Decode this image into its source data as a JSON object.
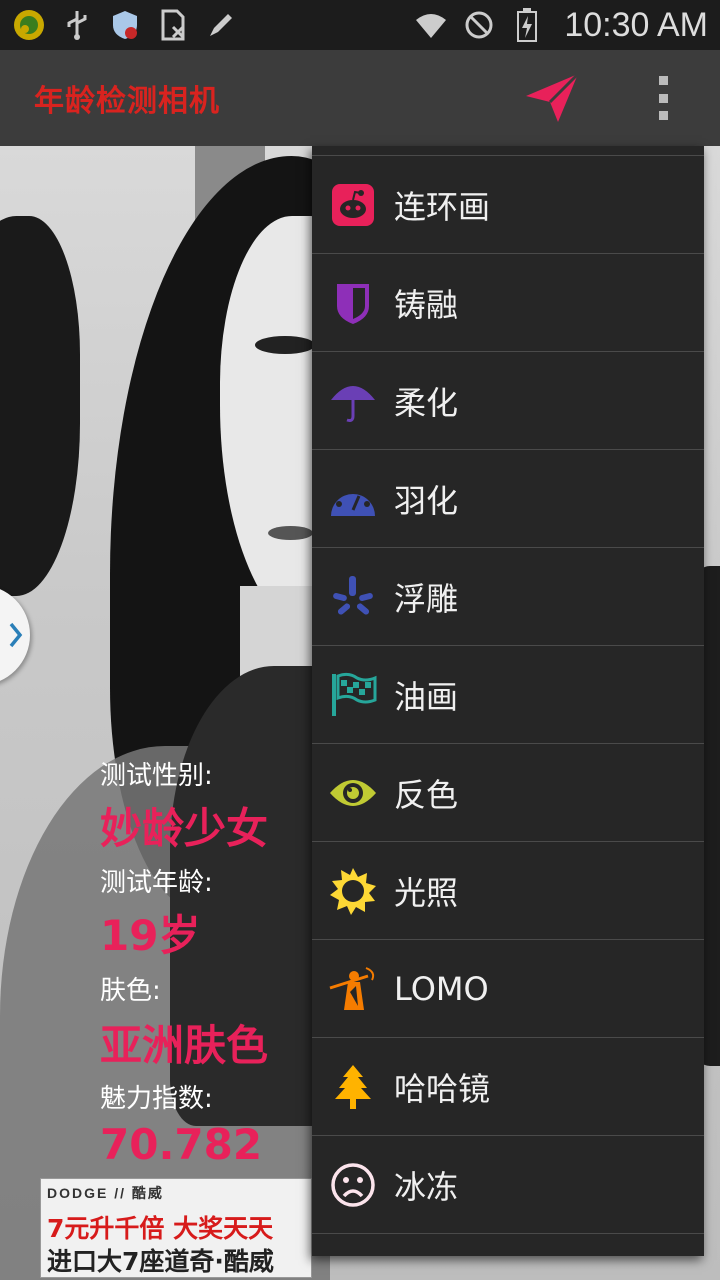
{
  "statusbar": {
    "time": "10:30 AM",
    "icons": [
      "music-app-icon",
      "usb-icon",
      "shield-icon",
      "sim-icon",
      "edit-icon",
      "wifi-icon",
      "block-icon",
      "battery-icon"
    ]
  },
  "actionbar": {
    "title": "年龄检测相机",
    "title_color": "#d9231f",
    "send_color": "#e8215a"
  },
  "results": {
    "gender_label": "测试性别:",
    "gender_value": "妙龄少女",
    "age_label": "测试年龄:",
    "age_value": "19岁",
    "skin_label": "肤色:",
    "skin_value": "亚洲肤色",
    "charm_label": "魅力指数:",
    "charm_value": "70.782",
    "value_color": "#e8215a"
  },
  "ad": {
    "brand": "DODGE // 酷威",
    "line1": "7元升千倍 大奖天天",
    "line2": "进口大7座道奇·酷威"
  },
  "menu": {
    "items": [
      {
        "label": "连环画",
        "icon": "reddit-icon",
        "color": "#e8215a"
      },
      {
        "label": "铸融",
        "icon": "badge-icon",
        "color": "#8e2fb8"
      },
      {
        "label": "柔化",
        "icon": "umbrella-icon",
        "color": "#6a3fb5"
      },
      {
        "label": "羽化",
        "icon": "dashboard-icon",
        "color": "#3f51b5"
      },
      {
        "label": "浮雕",
        "icon": "yelp-icon",
        "color": "#3f51b5"
      },
      {
        "label": "油画",
        "icon": "flag-checkered-icon",
        "color": "#26a69a"
      },
      {
        "label": "反色",
        "icon": "eye-icon",
        "color": "#c0ca33"
      },
      {
        "label": "光照",
        "icon": "sun-icon",
        "color": "#fdd835"
      },
      {
        "label": "LOMO",
        "icon": "soldier-icon",
        "color": "#f57c00"
      },
      {
        "label": "哈哈镜",
        "icon": "tree-icon",
        "color": "#ffb300"
      },
      {
        "label": "冰冻",
        "icon": "frown-icon",
        "color": "#fce4ec"
      }
    ]
  }
}
